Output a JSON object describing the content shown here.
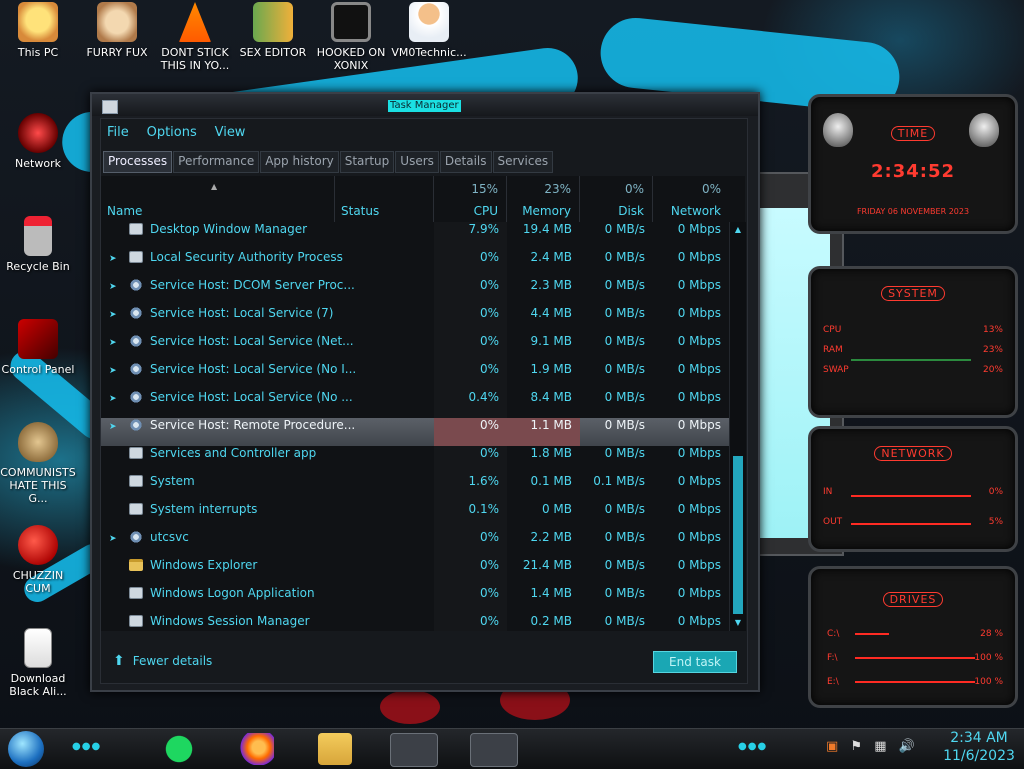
{
  "desktop": {
    "icons": [
      {
        "label": "This PC"
      },
      {
        "label": "FURRY FUX"
      },
      {
        "label": "DONT STICK THIS IN YO..."
      },
      {
        "label": "SEX EDITOR"
      },
      {
        "label": "HOOKED ON XONIX"
      },
      {
        "label": "VM0Technic..."
      },
      {
        "label": "Network"
      },
      {
        "label": "Recycle Bin"
      },
      {
        "label": "Control Panel"
      },
      {
        "label": "COMMUNISTS HATE THIS G..."
      },
      {
        "label": "CHUZZIN CUM"
      },
      {
        "label": "Download Black Ali..."
      }
    ]
  },
  "window": {
    "title": "Task Manager",
    "menu": [
      "File",
      "Options",
      "View"
    ],
    "tabs": [
      "Processes",
      "Performance",
      "App history",
      "Startup",
      "Users",
      "Details",
      "Services"
    ],
    "active_tab": "Processes",
    "columns": {
      "name": "Name",
      "status": "Status",
      "cpu": {
        "label": "CPU",
        "pct": "15%"
      },
      "memory": {
        "label": "Memory",
        "pct": "23%"
      },
      "disk": {
        "label": "Disk",
        "pct": "0%"
      },
      "network": {
        "label": "Network",
        "pct": "0%"
      }
    },
    "rows": [
      {
        "name": "Desktop Window Manager",
        "icon": "window",
        "expandable": false,
        "cpu": "7.9%",
        "memory": "19.4 MB",
        "disk": "0 MB/s",
        "network": "0 Mbps"
      },
      {
        "name": "Local Security Authority Process",
        "icon": "window",
        "expandable": true,
        "cpu": "0%",
        "memory": "2.4 MB",
        "disk": "0 MB/s",
        "network": "0 Mbps"
      },
      {
        "name": "Service Host: DCOM Server Proc...",
        "icon": "gear",
        "expandable": true,
        "cpu": "0%",
        "memory": "2.3 MB",
        "disk": "0 MB/s",
        "network": "0 Mbps"
      },
      {
        "name": "Service Host: Local Service (7)",
        "icon": "gear",
        "expandable": true,
        "cpu": "0%",
        "memory": "4.4 MB",
        "disk": "0 MB/s",
        "network": "0 Mbps"
      },
      {
        "name": "Service Host: Local Service (Net...",
        "icon": "gear",
        "expandable": true,
        "cpu": "0%",
        "memory": "9.1 MB",
        "disk": "0 MB/s",
        "network": "0 Mbps"
      },
      {
        "name": "Service Host: Local Service (No I...",
        "icon": "gear",
        "expandable": true,
        "cpu": "0%",
        "memory": "1.9 MB",
        "disk": "0 MB/s",
        "network": "0 Mbps"
      },
      {
        "name": "Service Host: Local Service (No ...",
        "icon": "gear",
        "expandable": true,
        "cpu": "0.4%",
        "memory": "8.4 MB",
        "disk": "0 MB/s",
        "network": "0 Mbps"
      },
      {
        "name": "Service Host: Remote Procedure...",
        "icon": "gear",
        "expandable": true,
        "selected": true,
        "cpu": "0%",
        "memory": "1.1 MB",
        "disk": "0 MB/s",
        "network": "0 Mbps"
      },
      {
        "name": "Services and Controller app",
        "icon": "window",
        "expandable": false,
        "cpu": "0%",
        "memory": "1.8 MB",
        "disk": "0 MB/s",
        "network": "0 Mbps"
      },
      {
        "name": "System",
        "icon": "window",
        "expandable": false,
        "cpu": "1.6%",
        "memory": "0.1 MB",
        "disk": "0.1 MB/s",
        "network": "0 Mbps"
      },
      {
        "name": "System interrupts",
        "icon": "window",
        "expandable": false,
        "cpu": "0.1%",
        "memory": "0 MB",
        "disk": "0 MB/s",
        "network": "0 Mbps"
      },
      {
        "name": "utcsvc",
        "icon": "gear",
        "expandable": true,
        "cpu": "0%",
        "memory": "2.2 MB",
        "disk": "0 MB/s",
        "network": "0 Mbps"
      },
      {
        "name": "Windows Explorer",
        "icon": "folder",
        "expandable": false,
        "cpu": "0%",
        "memory": "21.4 MB",
        "disk": "0 MB/s",
        "network": "0 Mbps"
      },
      {
        "name": "Windows Logon Application",
        "icon": "window",
        "expandable": false,
        "cpu": "0%",
        "memory": "1.4 MB",
        "disk": "0 MB/s",
        "network": "0 Mbps"
      },
      {
        "name": "Windows Session Manager",
        "icon": "window",
        "expandable": false,
        "cpu": "0%",
        "memory": "0.2 MB",
        "disk": "0 MB/s",
        "network": "0 Mbps"
      }
    ],
    "footer": {
      "fewer_details": "Fewer details",
      "end_task": "End task"
    }
  },
  "gadgets": {
    "time": {
      "title": "TIME",
      "clock": "2:34:52",
      "date": "FRIDAY 06 NOVEMBER 2023"
    },
    "system": {
      "title": "SYSTEM",
      "rows": [
        {
          "label": "CPU",
          "value": "13%"
        },
        {
          "label": "RAM",
          "value": "23%"
        },
        {
          "label": "SWAP",
          "value": "20%"
        }
      ]
    },
    "network": {
      "title": "NETWORK",
      "rows": [
        {
          "label": "IN",
          "value": "0%"
        },
        {
          "label": "OUT",
          "value": "5%"
        }
      ]
    },
    "drives": {
      "title": "DRIVES",
      "rows": [
        {
          "label": "C:\\",
          "value": "28 %"
        },
        {
          "label": "F:\\",
          "value": "100 %"
        },
        {
          "label": "E:\\",
          "value": "100 %"
        }
      ]
    }
  },
  "taskbar": {
    "apps": [
      "spotify-icon",
      "firefox-icon",
      "file-explorer-icon",
      "control-card-icon",
      "task-manager-icon"
    ],
    "time": "2:34 AM",
    "date": "11/6/2023"
  },
  "colors": {
    "accent": "#4fd7f0",
    "gadget_red": "#ff3b30",
    "selection": "#5b6068"
  }
}
